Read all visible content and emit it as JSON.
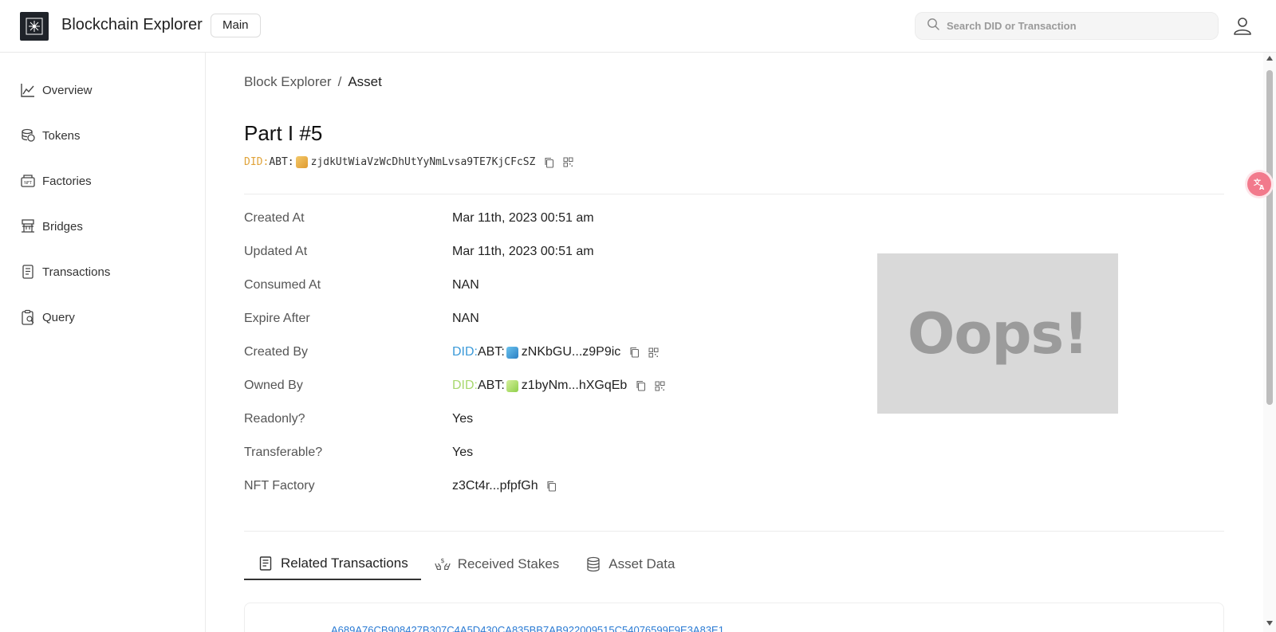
{
  "header": {
    "app_title": "Blockchain Explorer",
    "chain_label": "Main",
    "search_placeholder": "Search DID or Transaction"
  },
  "sidebar": {
    "items": [
      {
        "label": "Overview",
        "icon": "chart-line-icon"
      },
      {
        "label": "Tokens",
        "icon": "coins-icon"
      },
      {
        "label": "Factories",
        "icon": "nft-factory-icon"
      },
      {
        "label": "Bridges",
        "icon": "bridge-icon"
      },
      {
        "label": "Transactions",
        "icon": "receipt-icon"
      },
      {
        "label": "Query",
        "icon": "clipboard-query-icon"
      }
    ]
  },
  "breadcrumb": {
    "root": "Block Explorer",
    "separator": "/",
    "current": "Asset"
  },
  "asset": {
    "title": "Part I #5",
    "did_prefix": "DID:",
    "did_type": "ABT:",
    "did_address": "zjdkUtWiaVzWcDhUtYyNmLvsa9TE7KjCFcSZ"
  },
  "properties": [
    {
      "label": "Created At",
      "value": "Mar 11th, 2023 00:51 am"
    },
    {
      "label": "Updated At",
      "value": "Mar 11th, 2023 00:51 am"
    },
    {
      "label": "Consumed At",
      "value": "NAN"
    },
    {
      "label": "Expire After",
      "value": "NAN"
    },
    {
      "label": "Created By",
      "did_prefix": "DID:",
      "did_type": "ABT:",
      "value": "zNKbGU...z9P9ic"
    },
    {
      "label": "Owned By",
      "did_prefix": "DID:",
      "did_type": "ABT:",
      "value": "z1byNm...hXGqEb"
    },
    {
      "label": "Readonly?",
      "value": "Yes"
    },
    {
      "label": "Transferable?",
      "value": "Yes"
    },
    {
      "label": "NFT Factory",
      "value": "z3Ct4r...pfpfGh"
    }
  ],
  "image_placeholder": {
    "text": "Oops!"
  },
  "tabs": [
    {
      "label": "Related Transactions",
      "icon": "receipt-icon",
      "active": true
    },
    {
      "label": "Received Stakes",
      "icon": "hands-coin-icon",
      "active": false
    },
    {
      "label": "Asset Data",
      "icon": "database-icon",
      "active": false
    }
  ],
  "transactions": [
    {
      "hash": "A689A76CB908427B307C4A5D430CA835BB7AB922009515C54076599F9E3A83E1"
    }
  ],
  "colors": {
    "did_orange": "#e0a33a",
    "did_blue": "#3b9ad9",
    "did_green": "#a8d86e",
    "link_blue": "#2a7ad3",
    "translate_fab": "#f27a8c"
  }
}
